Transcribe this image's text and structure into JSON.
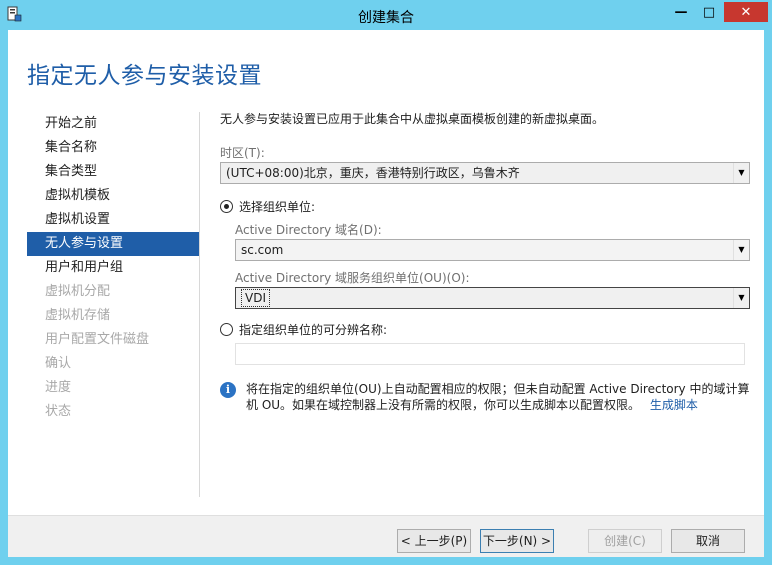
{
  "window": {
    "title": "创建集合",
    "minimize_glyph": "—",
    "maximize_glyph": "□",
    "close_glyph": "✕"
  },
  "page": {
    "title": "指定无人参与安装设置"
  },
  "steps": [
    {
      "label": "开始之前",
      "state": "normal"
    },
    {
      "label": "集合名称",
      "state": "normal"
    },
    {
      "label": "集合类型",
      "state": "normal"
    },
    {
      "label": "虚拟机模板",
      "state": "normal"
    },
    {
      "label": "虚拟机设置",
      "state": "normal"
    },
    {
      "label": "无人参与设置",
      "state": "active"
    },
    {
      "label": "用户和用户组",
      "state": "normal"
    },
    {
      "label": "虚拟机分配",
      "state": "disabled"
    },
    {
      "label": "虚拟机存储",
      "state": "disabled"
    },
    {
      "label": "用户配置文件磁盘",
      "state": "disabled"
    },
    {
      "label": "确认",
      "state": "disabled"
    },
    {
      "label": "进度",
      "state": "disabled"
    },
    {
      "label": "状态",
      "state": "disabled"
    }
  ],
  "content": {
    "intro": "无人参与安装设置已应用于此集合中从虚拟桌面模板创建的新虚拟桌面。",
    "timezone_label": "时区(T):",
    "timezone_value": "(UTC+08:00)北京，重庆，香港特别行政区，乌鲁木齐",
    "radio_ou_label": "选择组织单位:",
    "domain_label": "Active Directory 域名(D):",
    "domain_value": "sc.com",
    "ou_label": "Active Directory 域服务组织单位(OU)(O):",
    "ou_value": "VDI",
    "radio_dn_label": "指定组织单位的可分辨名称:",
    "dn_value": "",
    "info_text": "将在指定的组织单位(OU)上自动配置相应的权限；但未自动配置 Active Directory 中的域计算机 OU。如果在域控制器上没有所需的权限，你可以生成脚本以配置权限。",
    "info_link": "生成脚本",
    "info_icon": "i"
  },
  "footer": {
    "prev_label": "< 上一步(P)",
    "next_label": "下一步(N) >",
    "create_label": "创建(C)",
    "cancel_label": "取消"
  },
  "colors": {
    "accent": "#1f5ea8",
    "titlebar": "#6fd0ee",
    "close_button": "#c7372f"
  },
  "icons": {
    "app": "server-manager-icon",
    "dropdown": "chevron-down-icon",
    "info": "info-icon"
  }
}
